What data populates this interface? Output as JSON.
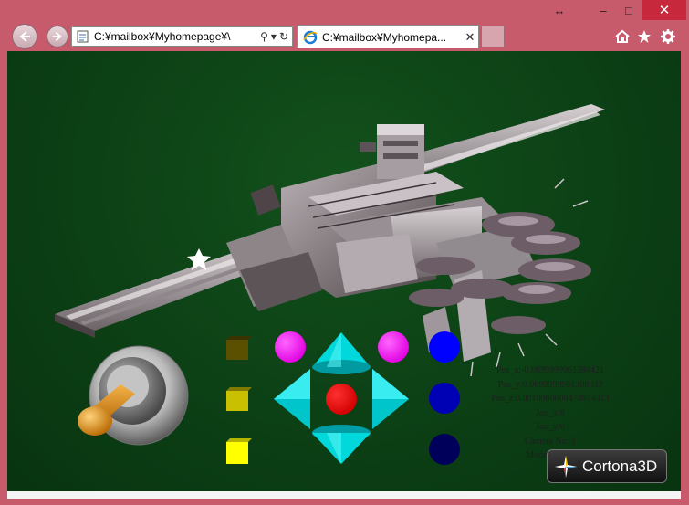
{
  "browser": {
    "address_text": "C:¥mailbox¥Myhomepage¥\\",
    "tab_title": "C:¥mailbox¥Myhomepa...",
    "colors": {
      "frame": "#c75b6c",
      "close_button": "#c8283b"
    },
    "icons": [
      "back-arrow-icon",
      "forward-arrow-icon",
      "search-icon",
      "dropdown-icon",
      "refresh-icon",
      "home-icon",
      "favorites-star-icon",
      "gear-icon",
      "close-icon",
      "ie-logo-icon"
    ]
  },
  "scene": {
    "background": "#0c4015",
    "controls": {
      "square_buttons_colors": [
        "#5a5000",
        "#c8c000",
        "#ffff00"
      ],
      "magenta_buttons": [
        "#ff22ff",
        "#ff22ff"
      ],
      "center_button": "#ff0000",
      "arrow_color": "#00d8dc",
      "blue_buttons_colors": [
        "#0000ff",
        "#0000b4",
        "#00005a"
      ]
    },
    "hud_lines": [
      "Pos_x:-0.0899999961380421",
      "Pos_y:0.0899999961308033",
      "Pos_z:0.0010000000474974313",
      "Joy_x:0",
      "Joy_y:0",
      "Camera No: 1",
      "Model: No: 1"
    ],
    "logo_text": "Cortona3D"
  }
}
